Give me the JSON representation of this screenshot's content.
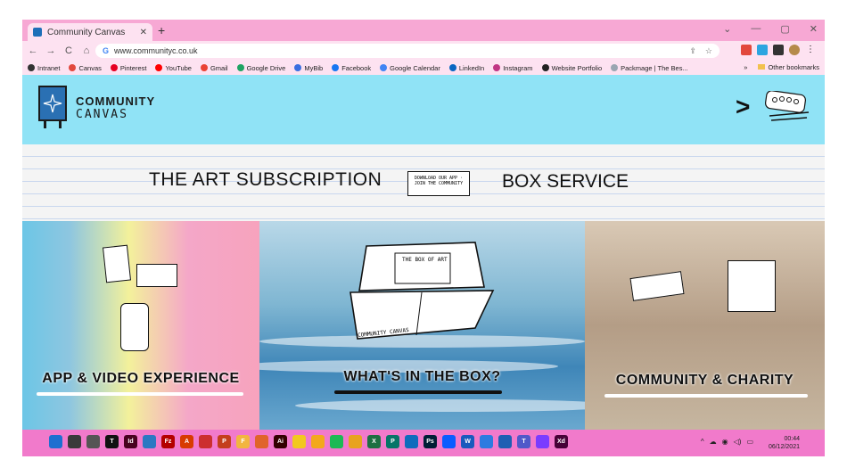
{
  "browser": {
    "tab_title": "Community Canvas",
    "tab_close": "✕",
    "new_tab": "+",
    "window_controls": [
      "⌄",
      "—",
      "▢",
      "✕"
    ],
    "nav": {
      "back": "←",
      "forward": "→",
      "reload": "C",
      "home": "⌂"
    },
    "url": "www.communityc.co.uk",
    "omnibox_icons": [
      "⇪",
      "☆"
    ],
    "bookmarks": [
      {
        "label": "Intranet",
        "color": "#333333"
      },
      {
        "label": "Canvas",
        "color": "#e2483d"
      },
      {
        "label": "Pinterest",
        "color": "#e60023"
      },
      {
        "label": "YouTube",
        "color": "#ff0000"
      },
      {
        "label": "Gmail",
        "color": "#ea4335"
      },
      {
        "label": "Google Drive",
        "color": "#1fa463"
      },
      {
        "label": "MyBib",
        "color": "#3b6fe0"
      },
      {
        "label": "Facebook",
        "color": "#1877f2"
      },
      {
        "label": "Google Calendar",
        "color": "#4285f4"
      },
      {
        "label": "LinkedIn",
        "color": "#0a66c2"
      },
      {
        "label": "Instagram",
        "color": "#c13584"
      },
      {
        "label": "Website Portfolio",
        "color": "#222222"
      },
      {
        "label": "Packmage | The Bes...",
        "color": "#9aa6b2"
      }
    ],
    "bookmarks_more": "»",
    "other_bookmarks": "Other bookmarks"
  },
  "site": {
    "brand_line1": "COMMUNITY",
    "brand_line2": "CANVAS",
    "menu_chevron": ">",
    "banner_left": "THE ART SUBSCRIPTION",
    "banner_right": "BOX SERVICE",
    "ticket_text": "DOWNLOAD OUR APP · JOIN THE COMMUNITY",
    "panels": [
      {
        "title": "APP & VIDEO  EXPERIENCE"
      },
      {
        "title": "WHAT'S IN THE BOX?"
      },
      {
        "title": "COMMUNITY & CHARITY"
      }
    ],
    "box_lid_text": "THE BOX OF ART",
    "box_side_text": "COMMUNITY CANVAS"
  },
  "taskbar": {
    "apps": [
      {
        "label": "",
        "color": "#1e6fd0"
      },
      {
        "label": "",
        "color": "#3a3a3a"
      },
      {
        "label": "",
        "color": "#555555"
      },
      {
        "label": "T",
        "color": "#111111"
      },
      {
        "label": "Id",
        "color": "#49021f"
      },
      {
        "label": "",
        "color": "#2b78c2"
      },
      {
        "label": "Fz",
        "color": "#b40000"
      },
      {
        "label": "A",
        "color": "#d83b01"
      },
      {
        "label": "",
        "color": "#cc2f2f"
      },
      {
        "label": "P",
        "color": "#c43e1c"
      },
      {
        "label": "F",
        "color": "#f2b540"
      },
      {
        "label": "",
        "color": "#e0642b"
      },
      {
        "label": "Ai",
        "color": "#330000"
      },
      {
        "label": "",
        "color": "#f2c81f"
      },
      {
        "label": "",
        "color": "#f3a81c"
      },
      {
        "label": "",
        "color": "#1db954"
      },
      {
        "label": "",
        "color": "#e8a31e"
      },
      {
        "label": "X",
        "color": "#1d6f42"
      },
      {
        "label": "P",
        "color": "#077568"
      },
      {
        "label": "",
        "color": "#0f6cbd"
      },
      {
        "label": "Ps",
        "color": "#001e36"
      },
      {
        "label": "",
        "color": "#0b5cff"
      },
      {
        "label": "W",
        "color": "#185abd"
      },
      {
        "label": "",
        "color": "#2d7be0"
      },
      {
        "label": "",
        "color": "#1e5fb3"
      },
      {
        "label": "T",
        "color": "#5059c9"
      },
      {
        "label": "",
        "color": "#7a3cff"
      },
      {
        "label": "Xd",
        "color": "#470137"
      }
    ],
    "tray_icons": [
      "^",
      "☁",
      "◉",
      "◁)",
      "▭"
    ],
    "time": "00:44",
    "date": "06/12/2021"
  }
}
